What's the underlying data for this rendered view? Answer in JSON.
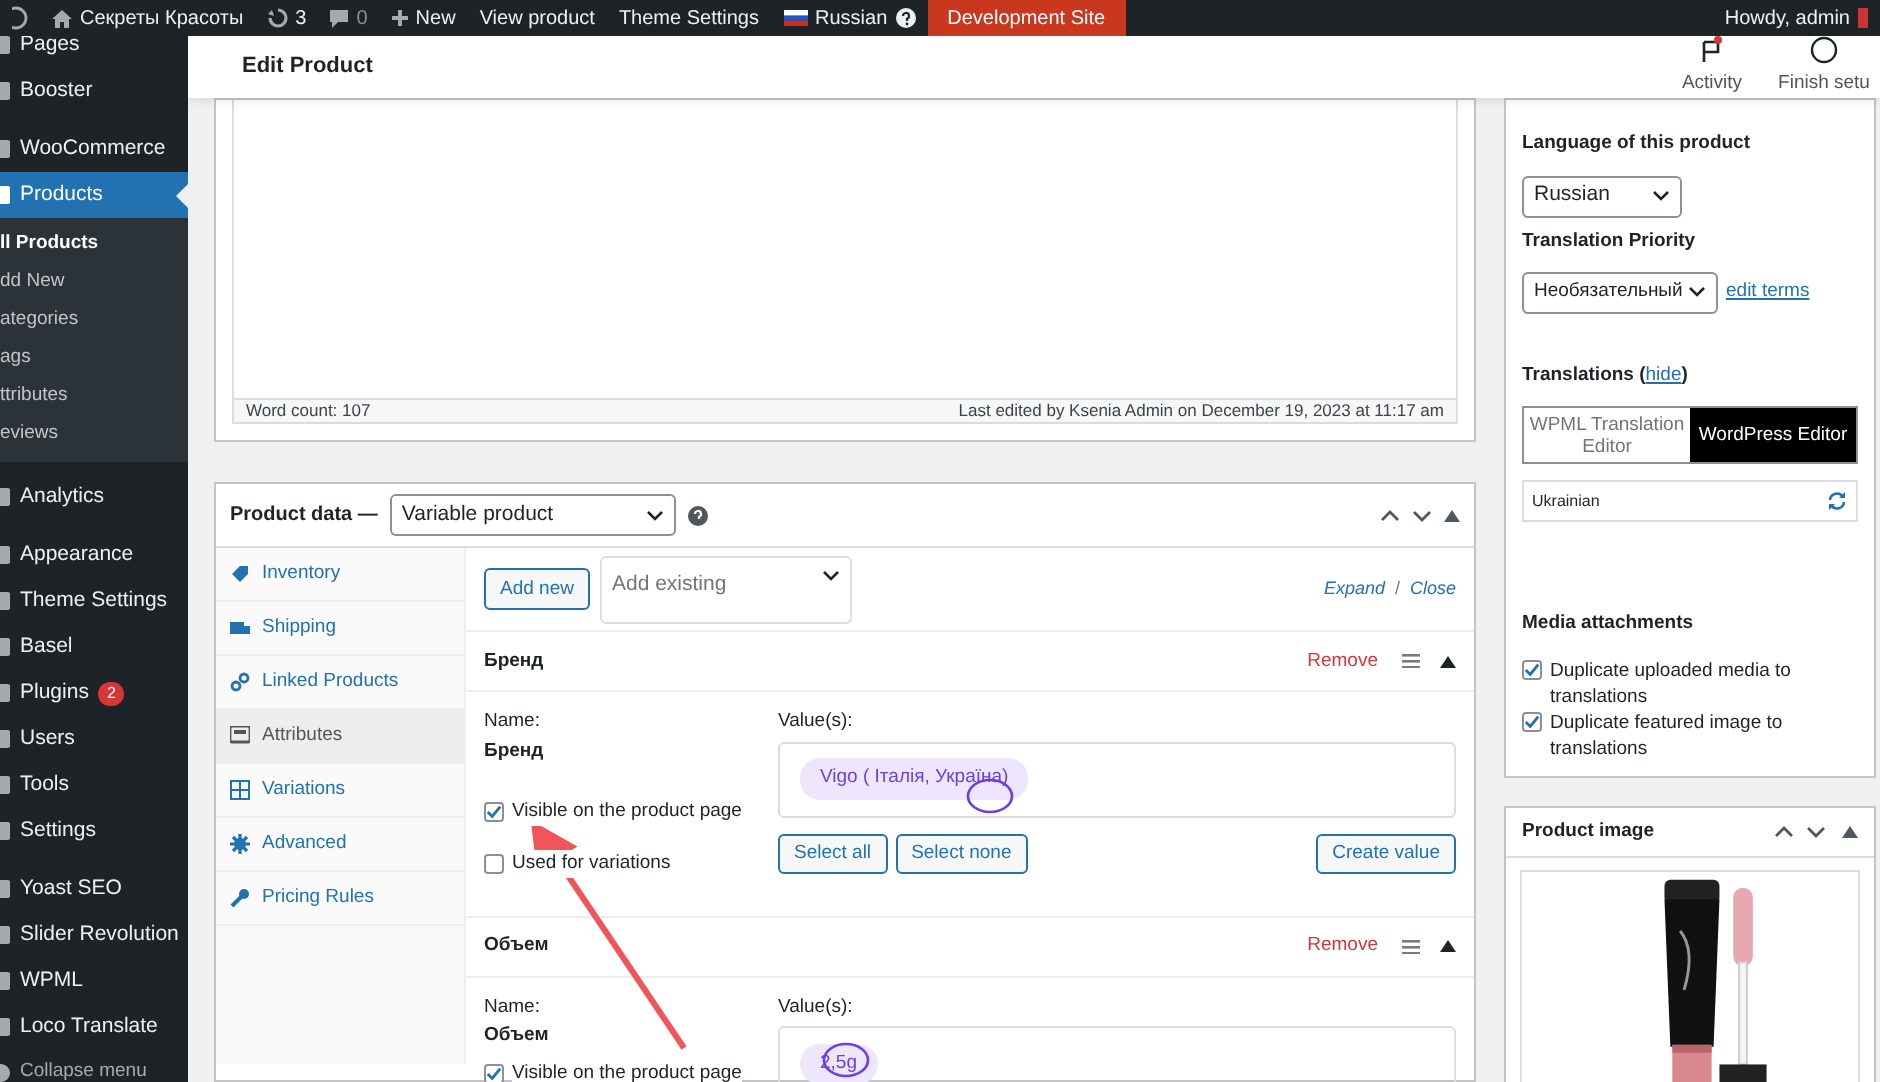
{
  "admin_bar": {
    "site": "Секреты Красоты",
    "updates": "3",
    "comments": "0",
    "new": "New",
    "links": [
      "View product",
      "Theme Settings"
    ],
    "language": "Russian",
    "dev_site": "Development Site",
    "greeting": "Howdy, admin"
  },
  "sidebar": {
    "items": [
      {
        "kind": "top",
        "label": "Pages",
        "selected": false
      },
      {
        "kind": "top",
        "label": "Booster",
        "selected": false
      },
      {
        "kind": "top",
        "label": "WooCommerce",
        "selected": false
      },
      {
        "kind": "top",
        "label": "Products",
        "selected": true
      },
      {
        "kind": "sub",
        "label": "ll Products",
        "selected": true
      },
      {
        "kind": "sub",
        "label": "dd New",
        "selected": false
      },
      {
        "kind": "sub",
        "label": "ategories",
        "selected": false
      },
      {
        "kind": "sub",
        "label": "ags",
        "selected": false
      },
      {
        "kind": "sub",
        "label": "ttributes",
        "selected": false
      },
      {
        "kind": "sub",
        "label": "eviews",
        "selected": false
      },
      {
        "kind": "top",
        "label": "Analytics",
        "selected": false
      },
      {
        "kind": "top",
        "label": "Appearance",
        "selected": false
      },
      {
        "kind": "top",
        "label": "Theme Settings",
        "selected": false
      },
      {
        "kind": "top",
        "label": "Basel",
        "selected": false
      },
      {
        "kind": "top",
        "label": "Plugins",
        "selected": false,
        "badge": "2"
      },
      {
        "kind": "top",
        "label": "Users",
        "selected": false
      },
      {
        "kind": "top",
        "label": "Tools",
        "selected": false
      },
      {
        "kind": "top",
        "label": "Settings",
        "selected": false
      },
      {
        "kind": "top",
        "label": "Yoast SEO",
        "selected": false
      },
      {
        "kind": "top",
        "label": "Slider Revolution",
        "selected": false
      },
      {
        "kind": "top",
        "label": "WPML",
        "selected": false
      },
      {
        "kind": "top",
        "label": "Loco Translate",
        "selected": false
      },
      {
        "kind": "collapse",
        "label": "Collapse menu"
      }
    ]
  },
  "header": {
    "title": "Edit Product",
    "actions": [
      "Activity",
      "Finish setu"
    ]
  },
  "editor": {
    "word_count": "Word count: 107",
    "last_edited": "Last edited by Ksenia Admin on December 19, 2023 at 11:17 am"
  },
  "product_data": {
    "label": "Product data —",
    "type": "Variable product",
    "tabs": [
      {
        "label": "Inventory",
        "selected": false
      },
      {
        "label": "Shipping",
        "selected": false
      },
      {
        "label": "Linked Products",
        "selected": false
      },
      {
        "label": "Attributes",
        "selected": true
      },
      {
        "label": "Variations",
        "selected": false
      },
      {
        "label": "Advanced",
        "selected": false
      },
      {
        "label": "Pricing Rules",
        "selected": false
      }
    ],
    "add_new": "Add new",
    "add_existing_placeholder": "Add existing",
    "expand": "Expand",
    "slash": "/",
    "close": "Close",
    "attributes": [
      {
        "name": "Бренд",
        "remove": "Remove",
        "name_label": "Name:",
        "name_value": "Бренд",
        "values_label": "Value(s):",
        "values": [
          "Vigo ( Італія, Україна)"
        ],
        "options": [
          {
            "label": "Visible on the product page",
            "checked": true
          },
          {
            "label": "Used for variations",
            "checked": false
          }
        ],
        "buttons": [
          "Select all",
          "Select none"
        ],
        "create": "Create value"
      },
      {
        "name": "Объем",
        "remove": "Remove",
        "name_label": "Name:",
        "name_value": "Объем",
        "values_label": "Value(s):",
        "values": [
          "2,5g"
        ],
        "options": [
          {
            "label": "Visible on the product page",
            "checked": true
          }
        ]
      }
    ]
  },
  "language_box": {
    "language_label": "Language of this product",
    "language": "Russian",
    "priority_label": "Translation Priority",
    "priority": "Необязательный",
    "edit_terms": "edit terms",
    "translations_before": "Translations (",
    "hide": "hide",
    "translations_after": ")",
    "editor_modes": [
      {
        "label": "WPML Translation Editor",
        "selected": false
      },
      {
        "label": "WordPress Editor",
        "selected": true
      }
    ],
    "languages": [
      "Ukrainian"
    ],
    "media_label": "Media attachments",
    "media_options": [
      {
        "label": "Duplicate uploaded media to translations",
        "checked": true
      },
      {
        "label": "Duplicate featured image to translations",
        "checked": true
      }
    ]
  },
  "product_image": {
    "title": "Product image",
    "kind": "picture"
  }
}
